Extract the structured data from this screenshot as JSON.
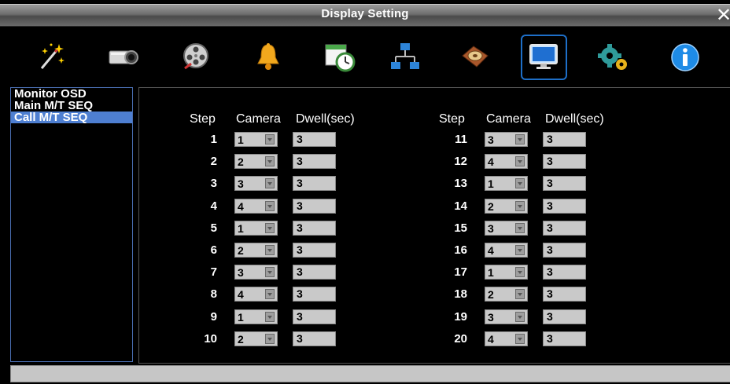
{
  "window": {
    "title": "Display Setting"
  },
  "toolbar": {
    "tools": [
      {
        "icon": "wizard-wand-icon"
      },
      {
        "icon": "camera-icon"
      },
      {
        "icon": "film-reel-icon"
      },
      {
        "icon": "alarm-bell-icon"
      },
      {
        "icon": "schedule-clock-icon"
      },
      {
        "icon": "network-icon"
      },
      {
        "icon": "hdd-icon"
      },
      {
        "icon": "display-monitor-icon",
        "active": true
      },
      {
        "icon": "gears-icon"
      },
      {
        "icon": "info-icon"
      }
    ]
  },
  "sidebar": {
    "items": [
      {
        "label": "Monitor OSD"
      },
      {
        "label": "Main M/T SEQ"
      },
      {
        "label": "Call M/T SEQ",
        "selected": true
      }
    ]
  },
  "table": {
    "headers": {
      "step": "Step",
      "camera": "Camera",
      "dwell": "Dwell(sec)"
    },
    "left": [
      {
        "step": "1",
        "camera": "1",
        "dwell": "3"
      },
      {
        "step": "2",
        "camera": "2",
        "dwell": "3"
      },
      {
        "step": "3",
        "camera": "3",
        "dwell": "3"
      },
      {
        "step": "4",
        "camera": "4",
        "dwell": "3"
      },
      {
        "step": "5",
        "camera": "1",
        "dwell": "3"
      },
      {
        "step": "6",
        "camera": "2",
        "dwell": "3"
      },
      {
        "step": "7",
        "camera": "3",
        "dwell": "3"
      },
      {
        "step": "8",
        "camera": "4",
        "dwell": "3"
      },
      {
        "step": "9",
        "camera": "1",
        "dwell": "3"
      },
      {
        "step": "10",
        "camera": "2",
        "dwell": "3"
      }
    ],
    "right": [
      {
        "step": "11",
        "camera": "3",
        "dwell": "3"
      },
      {
        "step": "12",
        "camera": "4",
        "dwell": "3"
      },
      {
        "step": "13",
        "camera": "1",
        "dwell": "3"
      },
      {
        "step": "14",
        "camera": "2",
        "dwell": "3"
      },
      {
        "step": "15",
        "camera": "3",
        "dwell": "3"
      },
      {
        "step": "16",
        "camera": "4",
        "dwell": "3"
      },
      {
        "step": "17",
        "camera": "1",
        "dwell": "3"
      },
      {
        "step": "18",
        "camera": "2",
        "dwell": "3"
      },
      {
        "step": "19",
        "camera": "3",
        "dwell": "3"
      },
      {
        "step": "20",
        "camera": "4",
        "dwell": "3"
      }
    ]
  },
  "colors": {
    "accent": "#1e6fc8",
    "selection": "#4e7fd1",
    "field": "#c9c9c9"
  }
}
